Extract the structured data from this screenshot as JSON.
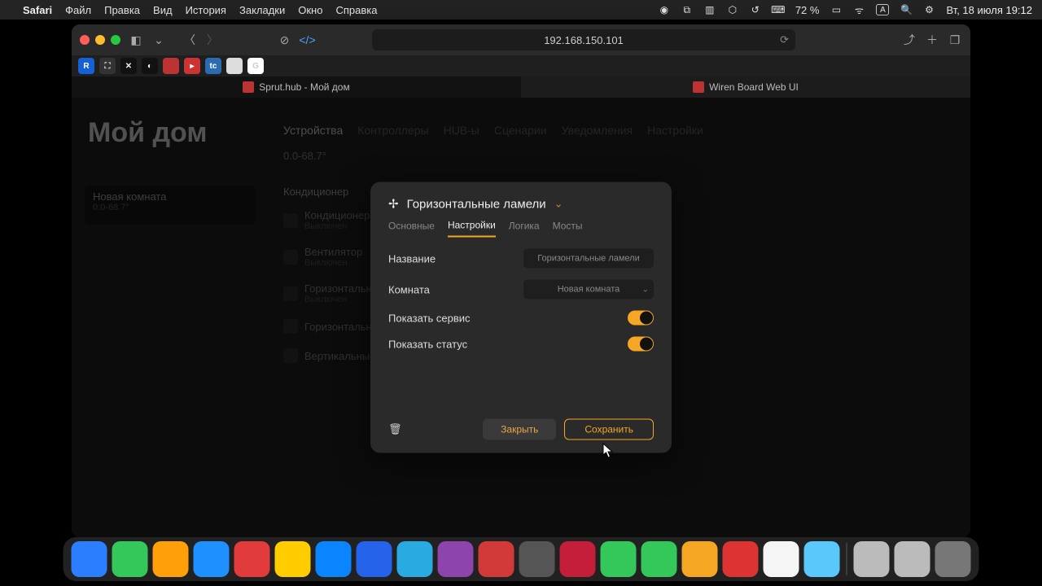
{
  "menubar": {
    "app": "Safari",
    "items": [
      "Файл",
      "Правка",
      "Вид",
      "История",
      "Закладки",
      "Окно",
      "Справка"
    ],
    "battery_pct": "72 %",
    "keyboard": "A",
    "datetime": "Вт, 18 июля  19:12"
  },
  "browser": {
    "url": "192.168.150.101",
    "tabs": [
      {
        "label": "Sprut.hub - Мой дом",
        "active": true
      },
      {
        "label": "Wiren Board Web UI",
        "active": false
      }
    ]
  },
  "page": {
    "title": "Мой дом",
    "nav": [
      "Устройства",
      "Контроллеры",
      "HUB-ы",
      "Сценарии",
      "Уведомления",
      "Настройки"
    ],
    "nav_active": 0,
    "sub_header": "0.0-68.7°",
    "side_card": {
      "title": "Новая комната",
      "sub": "0.0-68.7°"
    },
    "device_group": "Кондиционер",
    "devices": [
      {
        "name": "Кондиционер",
        "state": "Выключен"
      },
      {
        "name": "Вентилятор",
        "state": "Выключен"
      },
      {
        "name": "Горизонтальные ламели",
        "state": "Выключен"
      },
      {
        "name": "Горизонтальные ламели",
        "state": ""
      },
      {
        "name": "Вертикальные ламели",
        "state": ""
      }
    ]
  },
  "modal": {
    "title": "Горизонтальные ламели",
    "tabs": [
      "Основные",
      "Настройки",
      "Логика",
      "Мосты"
    ],
    "active_tab": 1,
    "fields": {
      "name_label": "Название",
      "name_value": "Горизонтальные ламели",
      "room_label": "Комната",
      "room_value": "Новая комната",
      "show_service_label": "Показать сервис",
      "show_status_label": "Показать статус"
    },
    "buttons": {
      "close": "Закрыть",
      "save": "Сохранить"
    }
  },
  "dock_colors": [
    "#2b7fff",
    "#34c759",
    "#ff9f0a",
    "#1e90ff",
    "#e23b3b",
    "#ffcc00",
    "#0a84ff",
    "#2563eb",
    "#29aae1",
    "#8e44ad",
    "#d23a3a",
    "#555",
    "#c41e3a",
    "#34c759",
    "#34c759",
    "#f5a623",
    "#d33",
    "#f5f5f5",
    "#5ac8fa",
    "#bbb",
    "#bbb",
    "#777"
  ]
}
